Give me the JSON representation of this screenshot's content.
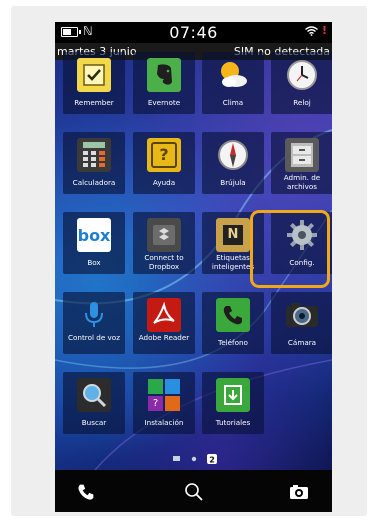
{
  "status": {
    "time": "07:46",
    "nfc_symbol": "ℕ",
    "alert_symbol": "!"
  },
  "date_bar": {
    "date": "martes 3 junio",
    "sim": "SIM no detectada"
  },
  "apps": [
    {
      "label": "Remember",
      "icon": "remember-icon"
    },
    {
      "label": "Evernote",
      "icon": "evernote-icon"
    },
    {
      "label": "Clima",
      "icon": "weather-icon"
    },
    {
      "label": "Reloj",
      "icon": "clock-icon"
    },
    {
      "label": "Calculadora",
      "icon": "calculator-icon"
    },
    {
      "label": "Ayuda",
      "icon": "help-icon",
      "glyph": "?"
    },
    {
      "label": "Brújula",
      "icon": "compass-icon"
    },
    {
      "label": "Admin. de archivos",
      "icon": "file-manager-icon"
    },
    {
      "label": "Box",
      "icon": "box-icon",
      "glyph": "box"
    },
    {
      "label": "Connect to Dropbox",
      "icon": "dropbox-icon"
    },
    {
      "label": "Etiquetas inteligentes",
      "icon": "smart-tags-icon",
      "glyph": "N"
    },
    {
      "label": "Config.",
      "icon": "gear-icon"
    },
    {
      "label": "Control de voz",
      "icon": "microphone-icon"
    },
    {
      "label": "Adobe Reader",
      "icon": "adobe-reader-icon"
    },
    {
      "label": "Teléfono",
      "icon": "phone-icon"
    },
    {
      "label": "Cámara",
      "icon": "camera-icon"
    },
    {
      "label": "Buscar",
      "icon": "search-icon"
    },
    {
      "label": "Instalación",
      "icon": "setup-icon",
      "glyph": "?"
    },
    {
      "label": "Tutoriales",
      "icon": "tutorials-icon"
    }
  ],
  "pager": {
    "current": "2"
  },
  "colors": {
    "highlight": "#f0a818",
    "accent_blue": "#2a4cbb"
  }
}
